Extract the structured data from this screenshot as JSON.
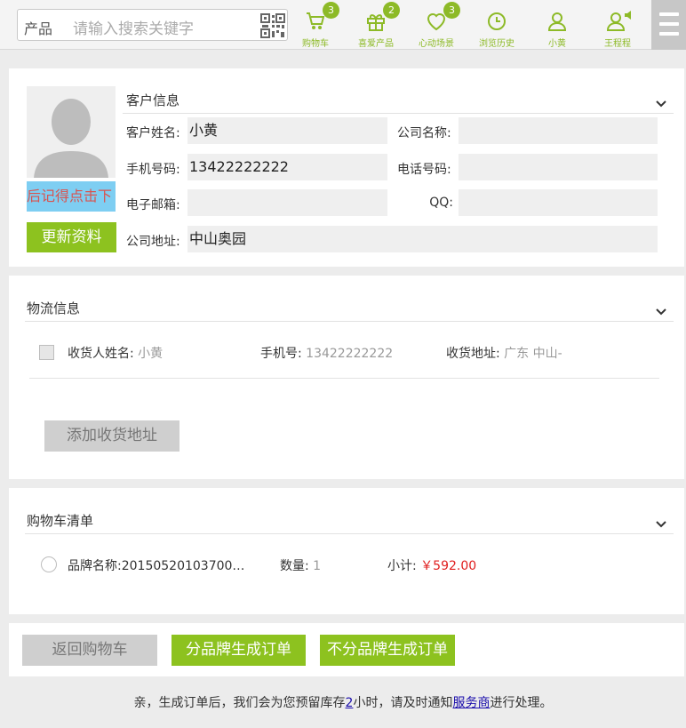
{
  "header": {
    "search_category": "产品",
    "search_placeholder": "请输入搜索关键字",
    "nav": [
      {
        "label": "购物车",
        "badge": "3",
        "icon": "cart-icon"
      },
      {
        "label": "喜爱产品",
        "badge": "2",
        "icon": "gift-icon"
      },
      {
        "label": "心动场景",
        "badge": "3",
        "icon": "heart-icon"
      },
      {
        "label": "浏览历史",
        "badge": "",
        "icon": "clock-icon"
      },
      {
        "label": "小黄",
        "badge": "",
        "icon": "user-icon"
      },
      {
        "label": "王程程",
        "badge": "",
        "icon": "user-speaker-icon"
      }
    ],
    "accent_color": "#8dba27"
  },
  "customer": {
    "section_title": "客户信息",
    "marquee_text": "后记得点击下",
    "update_button": "更新资料",
    "fields": {
      "name_label": "客户姓名:",
      "name_value": "小黄",
      "company_label": "公司名称:",
      "company_value": "",
      "mobile_label": "手机号码:",
      "mobile_value": "13422222222",
      "phone_label": "电话号码:",
      "phone_value": "",
      "email_label": "电子邮箱:",
      "email_value": "",
      "qq_label": "QQ:",
      "qq_value": "",
      "address_label": "公司地址:",
      "address_value": "中山奥园"
    }
  },
  "logistics": {
    "section_title": "物流信息",
    "receiver_label": "收货人姓名:",
    "receiver_value": "小黄",
    "mobile_label": "手机号:",
    "mobile_value": "13422222222",
    "address_label": "收货地址:",
    "address_value": "广东 中山-",
    "add_button": "添加收货地址"
  },
  "cart": {
    "section_title": "购物车清单",
    "items": [
      {
        "brand": "品牌名称:20150520103700…",
        "qty_label": "数量:",
        "qty": "1",
        "subtotal_label": "小计:",
        "subtotal": "￥592.00"
      }
    ]
  },
  "actions": {
    "back_button": "返回购物车",
    "by_brand_button": "分品牌生成订单",
    "no_brand_button": "不分品牌生成订单"
  },
  "footer": {
    "note_prefix": "亲，生成订单后，我们会为您预留库存",
    "hours": "2",
    "note_mid": "小时，请及时通知",
    "link": "服务商",
    "note_suffix": "进行处理。"
  }
}
